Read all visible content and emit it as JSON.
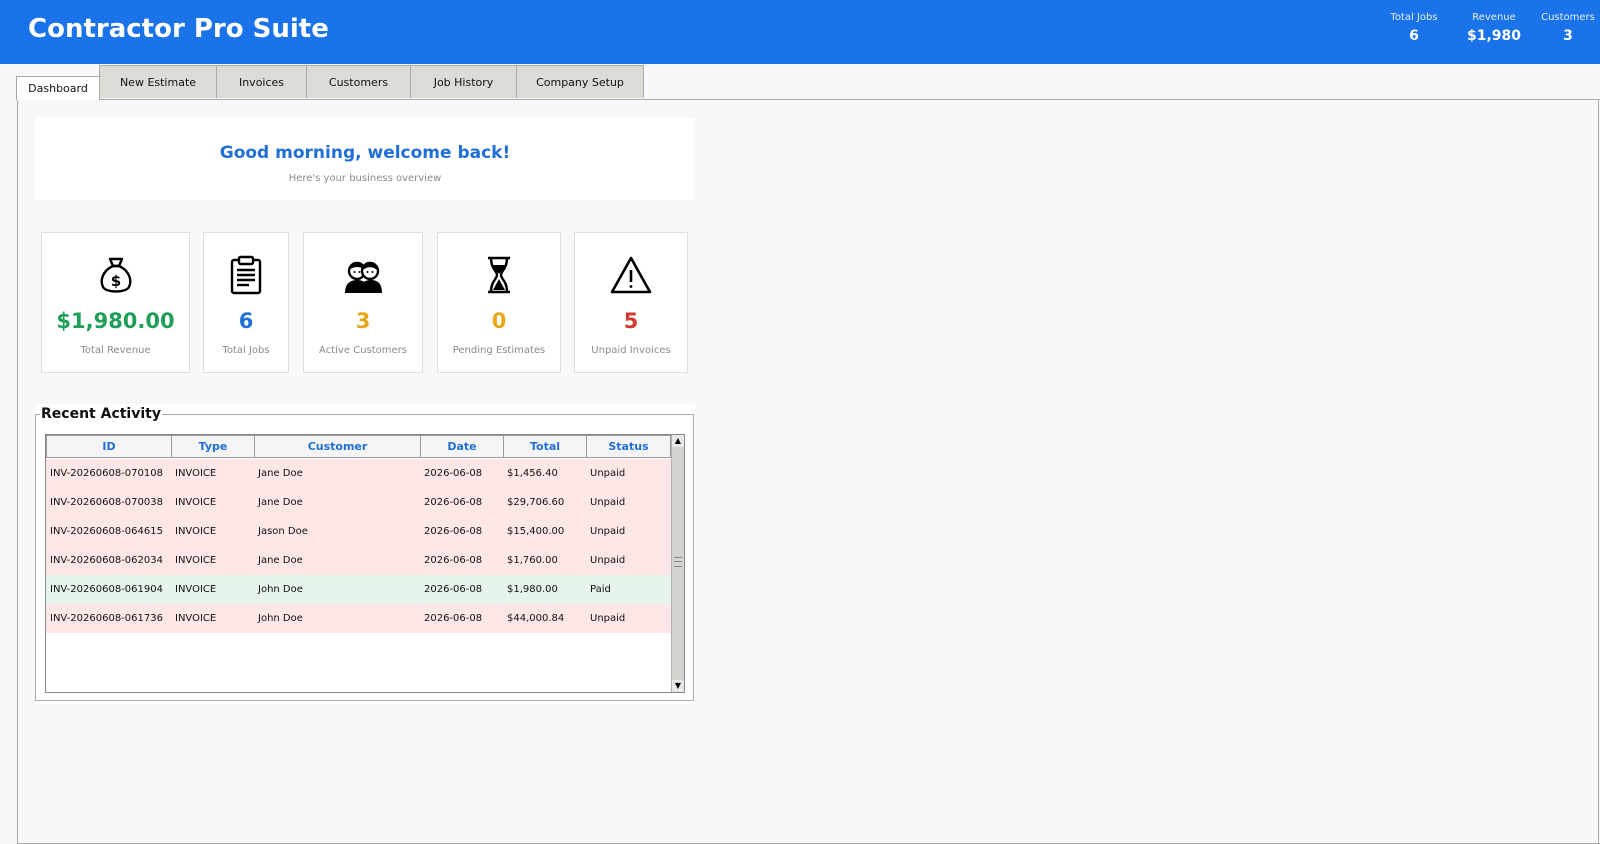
{
  "header": {
    "title": "Contractor Pro Suite",
    "stats": [
      {
        "label": "Total Jobs",
        "value": "6"
      },
      {
        "label": "Revenue",
        "value": "$1,980"
      },
      {
        "label": "Customers",
        "value": "3"
      }
    ]
  },
  "tabs": [
    {
      "label": "Dashboard",
      "active": true
    },
    {
      "label": "New Estimate"
    },
    {
      "label": "Invoices"
    },
    {
      "label": "Customers"
    },
    {
      "label": "Job History"
    },
    {
      "label": "Company Setup"
    }
  ],
  "welcome": {
    "title": "Good morning, welcome back!",
    "subtitle": "Here's your business overview"
  },
  "cards": [
    {
      "icon": "money-bag-icon",
      "value": "$1,980.00",
      "label": "Total Revenue",
      "color": "#1e9e57"
    },
    {
      "icon": "clipboard-icon",
      "value": "6",
      "label": "Total Jobs",
      "color": "#1f6fd6"
    },
    {
      "icon": "people-icon",
      "value": "3",
      "label": "Active Customers",
      "color": "#e6a817"
    },
    {
      "icon": "hourglass-icon",
      "value": "0",
      "label": "Pending Estimates",
      "color": "#e6a817"
    },
    {
      "icon": "warning-icon",
      "value": "5",
      "label": "Unpaid Invoices",
      "color": "#d13a2f"
    }
  ],
  "recent_activity": {
    "title": "Recent Activity",
    "columns": [
      "ID",
      "Type",
      "Customer",
      "Date",
      "Total",
      "Status"
    ],
    "rows": [
      [
        "INV-20260608-070108",
        "INVOICE",
        "Jane Doe",
        "2026-06-08",
        "$1,456.40",
        "Unpaid"
      ],
      [
        "INV-20260608-070038",
        "INVOICE",
        "Jane Doe",
        "2026-06-08",
        "$29,706.60",
        "Unpaid"
      ],
      [
        "INV-20260608-064615",
        "INVOICE",
        "Jason Doe",
        "2026-06-08",
        "$15,400.00",
        "Unpaid"
      ],
      [
        "INV-20260608-062034",
        "INVOICE",
        "Jane Doe",
        "2026-06-08",
        "$1,760.00",
        "Unpaid"
      ],
      [
        "INV-20260608-061904",
        "INVOICE",
        "John Doe",
        "2026-06-08",
        "$1,980.00",
        "Paid"
      ],
      [
        "INV-20260608-061736",
        "INVOICE",
        "John Doe",
        "2026-06-08",
        "$44,000.84",
        "Unpaid"
      ]
    ],
    "status_colors": {
      "Unpaid": "#fde7e6",
      "Paid": "#e6f4ea"
    }
  },
  "colors": {
    "header_bg": "#1a73e8",
    "accent": "#1f6fd6"
  }
}
